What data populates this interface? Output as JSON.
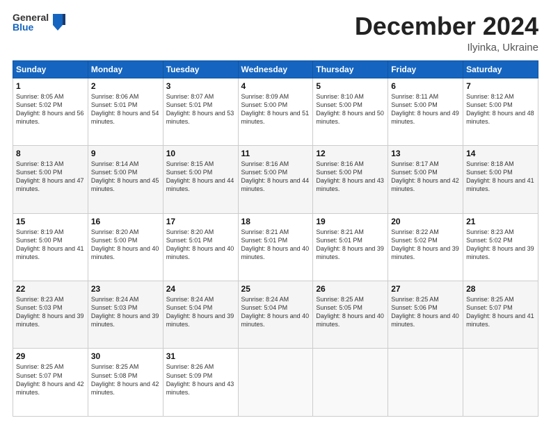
{
  "header": {
    "logo_general": "General",
    "logo_blue": "Blue",
    "month": "December 2024",
    "location": "Ilyinka, Ukraine"
  },
  "weekdays": [
    "Sunday",
    "Monday",
    "Tuesday",
    "Wednesday",
    "Thursday",
    "Friday",
    "Saturday"
  ],
  "weeks": [
    [
      {
        "day": "1",
        "sunrise": "Sunrise: 8:05 AM",
        "sunset": "Sunset: 5:02 PM",
        "daylight": "Daylight: 8 hours and 56 minutes."
      },
      {
        "day": "2",
        "sunrise": "Sunrise: 8:06 AM",
        "sunset": "Sunset: 5:01 PM",
        "daylight": "Daylight: 8 hours and 54 minutes."
      },
      {
        "day": "3",
        "sunrise": "Sunrise: 8:07 AM",
        "sunset": "Sunset: 5:01 PM",
        "daylight": "Daylight: 8 hours and 53 minutes."
      },
      {
        "day": "4",
        "sunrise": "Sunrise: 8:09 AM",
        "sunset": "Sunset: 5:00 PM",
        "daylight": "Daylight: 8 hours and 51 minutes."
      },
      {
        "day": "5",
        "sunrise": "Sunrise: 8:10 AM",
        "sunset": "Sunset: 5:00 PM",
        "daylight": "Daylight: 8 hours and 50 minutes."
      },
      {
        "day": "6",
        "sunrise": "Sunrise: 8:11 AM",
        "sunset": "Sunset: 5:00 PM",
        "daylight": "Daylight: 8 hours and 49 minutes."
      },
      {
        "day": "7",
        "sunrise": "Sunrise: 8:12 AM",
        "sunset": "Sunset: 5:00 PM",
        "daylight": "Daylight: 8 hours and 48 minutes."
      }
    ],
    [
      {
        "day": "8",
        "sunrise": "Sunrise: 8:13 AM",
        "sunset": "Sunset: 5:00 PM",
        "daylight": "Daylight: 8 hours and 47 minutes."
      },
      {
        "day": "9",
        "sunrise": "Sunrise: 8:14 AM",
        "sunset": "Sunset: 5:00 PM",
        "daylight": "Daylight: 8 hours and 45 minutes."
      },
      {
        "day": "10",
        "sunrise": "Sunrise: 8:15 AM",
        "sunset": "Sunset: 5:00 PM",
        "daylight": "Daylight: 8 hours and 44 minutes."
      },
      {
        "day": "11",
        "sunrise": "Sunrise: 8:16 AM",
        "sunset": "Sunset: 5:00 PM",
        "daylight": "Daylight: 8 hours and 44 minutes."
      },
      {
        "day": "12",
        "sunrise": "Sunrise: 8:16 AM",
        "sunset": "Sunset: 5:00 PM",
        "daylight": "Daylight: 8 hours and 43 minutes."
      },
      {
        "day": "13",
        "sunrise": "Sunrise: 8:17 AM",
        "sunset": "Sunset: 5:00 PM",
        "daylight": "Daylight: 8 hours and 42 minutes."
      },
      {
        "day": "14",
        "sunrise": "Sunrise: 8:18 AM",
        "sunset": "Sunset: 5:00 PM",
        "daylight": "Daylight: 8 hours and 41 minutes."
      }
    ],
    [
      {
        "day": "15",
        "sunrise": "Sunrise: 8:19 AM",
        "sunset": "Sunset: 5:00 PM",
        "daylight": "Daylight: 8 hours and 41 minutes."
      },
      {
        "day": "16",
        "sunrise": "Sunrise: 8:20 AM",
        "sunset": "Sunset: 5:00 PM",
        "daylight": "Daylight: 8 hours and 40 minutes."
      },
      {
        "day": "17",
        "sunrise": "Sunrise: 8:20 AM",
        "sunset": "Sunset: 5:01 PM",
        "daylight": "Daylight: 8 hours and 40 minutes."
      },
      {
        "day": "18",
        "sunrise": "Sunrise: 8:21 AM",
        "sunset": "Sunset: 5:01 PM",
        "daylight": "Daylight: 8 hours and 40 minutes."
      },
      {
        "day": "19",
        "sunrise": "Sunrise: 8:21 AM",
        "sunset": "Sunset: 5:01 PM",
        "daylight": "Daylight: 8 hours and 39 minutes."
      },
      {
        "day": "20",
        "sunrise": "Sunrise: 8:22 AM",
        "sunset": "Sunset: 5:02 PM",
        "daylight": "Daylight: 8 hours and 39 minutes."
      },
      {
        "day": "21",
        "sunrise": "Sunrise: 8:23 AM",
        "sunset": "Sunset: 5:02 PM",
        "daylight": "Daylight: 8 hours and 39 minutes."
      }
    ],
    [
      {
        "day": "22",
        "sunrise": "Sunrise: 8:23 AM",
        "sunset": "Sunset: 5:03 PM",
        "daylight": "Daylight: 8 hours and 39 minutes."
      },
      {
        "day": "23",
        "sunrise": "Sunrise: 8:24 AM",
        "sunset": "Sunset: 5:03 PM",
        "daylight": "Daylight: 8 hours and 39 minutes."
      },
      {
        "day": "24",
        "sunrise": "Sunrise: 8:24 AM",
        "sunset": "Sunset: 5:04 PM",
        "daylight": "Daylight: 8 hours and 39 minutes."
      },
      {
        "day": "25",
        "sunrise": "Sunrise: 8:24 AM",
        "sunset": "Sunset: 5:04 PM",
        "daylight": "Daylight: 8 hours and 40 minutes."
      },
      {
        "day": "26",
        "sunrise": "Sunrise: 8:25 AM",
        "sunset": "Sunset: 5:05 PM",
        "daylight": "Daylight: 8 hours and 40 minutes."
      },
      {
        "day": "27",
        "sunrise": "Sunrise: 8:25 AM",
        "sunset": "Sunset: 5:06 PM",
        "daylight": "Daylight: 8 hours and 40 minutes."
      },
      {
        "day": "28",
        "sunrise": "Sunrise: 8:25 AM",
        "sunset": "Sunset: 5:07 PM",
        "daylight": "Daylight: 8 hours and 41 minutes."
      }
    ],
    [
      {
        "day": "29",
        "sunrise": "Sunrise: 8:25 AM",
        "sunset": "Sunset: 5:07 PM",
        "daylight": "Daylight: 8 hours and 42 minutes."
      },
      {
        "day": "30",
        "sunrise": "Sunrise: 8:25 AM",
        "sunset": "Sunset: 5:08 PM",
        "daylight": "Daylight: 8 hours and 42 minutes."
      },
      {
        "day": "31",
        "sunrise": "Sunrise: 8:26 AM",
        "sunset": "Sunset: 5:09 PM",
        "daylight": "Daylight: 8 hours and 43 minutes."
      },
      null,
      null,
      null,
      null
    ]
  ]
}
